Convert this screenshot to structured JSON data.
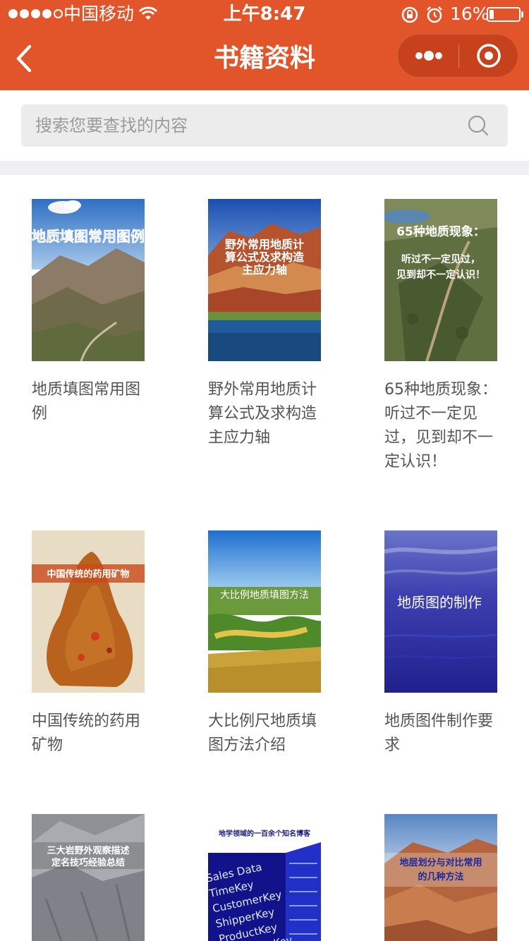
{
  "status_bar": {
    "carrier": "中国移动",
    "time": "上午8:47",
    "battery": "16%",
    "battery_level": 0.16
  },
  "nav": {
    "title": "书籍资料",
    "back_icon": "chevron-left-icon",
    "more_icon": "more-dots-icon",
    "close_icon": "target-close-icon"
  },
  "search": {
    "placeholder": "搜索您要查找的内容",
    "value": "",
    "icon": "search-icon"
  },
  "books": [
    {
      "title": "地质填图常用图例",
      "cover_text": "地质填图常用图例"
    },
    {
      "title": "野外常用地质计算公式及求构造主应力轴",
      "cover_text": "野外常用地质计算公式及求构造主应力轴"
    },
    {
      "title": "65种地质现象：听过不一定见过，见到却不一定认识！",
      "cover_text": "65种地质现象：听过不一定见过，见到却不一定认识！"
    },
    {
      "title": "中国传统的药用矿物",
      "cover_text": "中国传统的药用矿物"
    },
    {
      "title": "大比例尺地质填图方法介绍",
      "cover_text": "大比例地质填图方法"
    },
    {
      "title": "地质图件制作要求",
      "cover_text": "地质图的制作"
    },
    {
      "title": "",
      "cover_text": "三大岩野外观察描述定名技巧经验总结"
    },
    {
      "title": "",
      "cover_text": "地学领域的一百余个知名博客",
      "cover_words": [
        "Sales Data",
        "TimeKey",
        "CustomerKey",
        "ShipperKey",
        "ProductKey",
        "EmployeeKey"
      ]
    },
    {
      "title": "",
      "cover_text": "地层划分与对比常用的几种方法"
    }
  ]
}
